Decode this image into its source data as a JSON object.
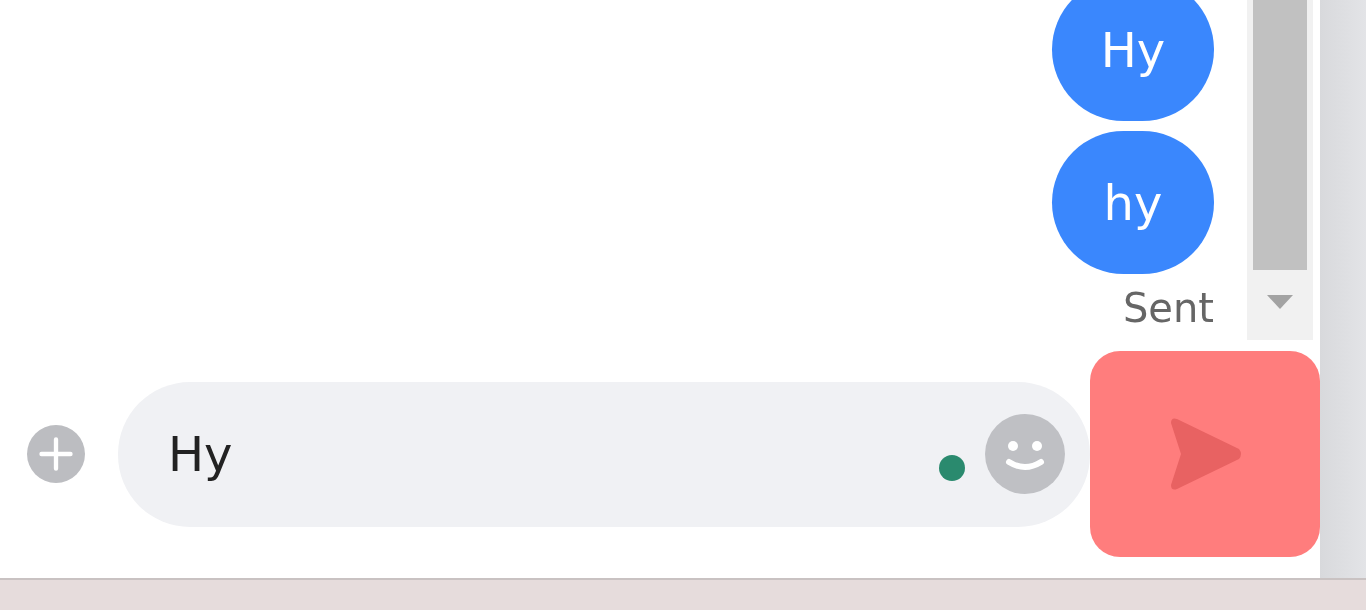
{
  "messages": [
    {
      "text": "Hy",
      "kind": "sent"
    },
    {
      "text": "hy",
      "kind": "sent"
    }
  ],
  "delivery_status": "Sent",
  "composer": {
    "value": "Hy",
    "online": true
  },
  "send_button": {
    "highlighted": true
  }
}
